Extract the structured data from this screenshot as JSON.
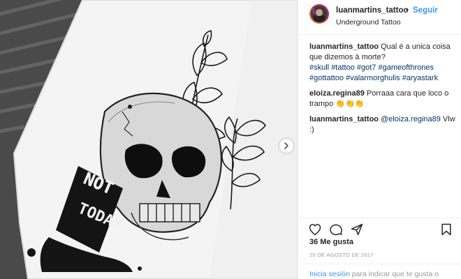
{
  "post": {
    "author": "luanmartins_tattoo",
    "separator": "•",
    "follow_label": "Seguir",
    "location": "Underground Tattoo",
    "image_caption_text": "NOT TODAY",
    "caption": {
      "user": "luanmartins_tattoo",
      "text": "Qual é a unica coisa que dizemos à morte?",
      "hashtags": [
        "#skull",
        "#tattoo",
        "#got7",
        "#gameofthrones",
        "#gottattoo",
        "#valarmorghulis",
        "#aryastark"
      ]
    },
    "comments": [
      {
        "user": "eloiza.regina89",
        "text": "Porraaa cara que loco o trampo",
        "emoji": "👏👏👏"
      },
      {
        "user": "luanmartins_tattoo",
        "mention": "@eloiza.regina89",
        "text": "Vlw :)"
      }
    ],
    "likes_text": "36 Me gusta",
    "date_text": "20 DE AGOSTO DE 2017",
    "login_link": "Inicia sesión",
    "login_suffix": "para indicar que te gusta o"
  },
  "icons": {
    "like": "heart-icon",
    "comment": "comment-bubble-icon",
    "share": "share-arrow-icon",
    "save": "bookmark-icon",
    "next": "chevron-right-icon"
  },
  "colors": {
    "link_blue": "#3897f0",
    "hashtag_blue": "#003569",
    "text": "#262626",
    "muted": "#999999",
    "border": "#efefef"
  }
}
